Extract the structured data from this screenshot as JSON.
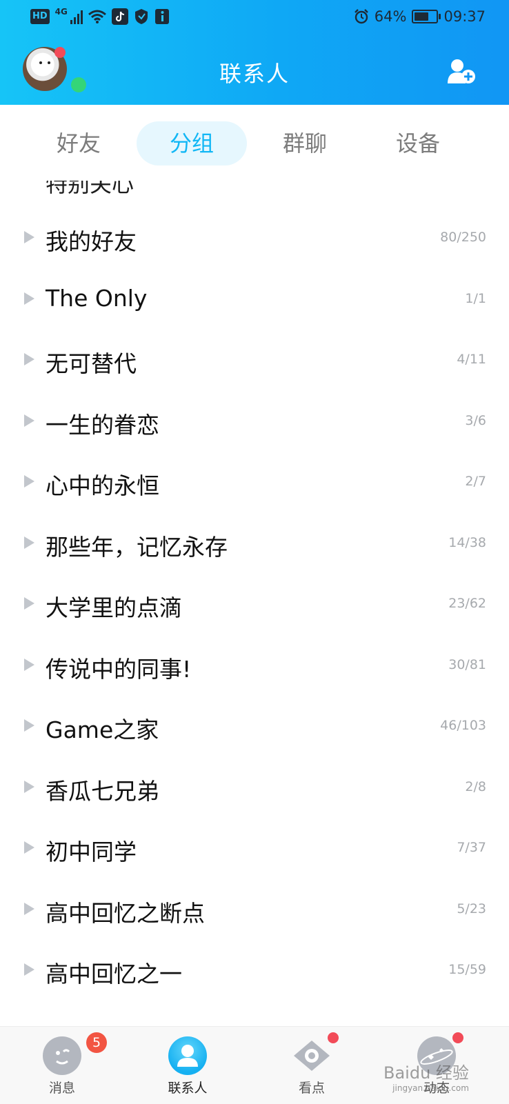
{
  "status_bar": {
    "hd": "HD",
    "network": "4G",
    "battery_percent": "64%",
    "battery_level": 0.64,
    "time": "09:37",
    "icons": [
      "signal-icon",
      "wifi-icon",
      "tiktok-icon",
      "shield-icon",
      "info-icon",
      "alarm-icon",
      "battery-icon"
    ]
  },
  "header": {
    "title": "联系人",
    "add_contact_icon": "add-contact-icon",
    "accent_color": "#12b7f5"
  },
  "tabs": [
    {
      "label": "好友"
    },
    {
      "label": "分组",
      "active": true
    },
    {
      "label": "群聊"
    },
    {
      "label": "设备"
    }
  ],
  "partial_row": "特别关心",
  "groups": [
    {
      "name": "我的好友",
      "count": "80/250"
    },
    {
      "name": "The Only",
      "count": "1/1"
    },
    {
      "name": "无可替代",
      "count": "4/11"
    },
    {
      "name": "一生的眷恋",
      "count": "3/6"
    },
    {
      "name": "心中的永恒",
      "count": "2/7"
    },
    {
      "name": "那些年，记忆永存",
      "count": "14/38"
    },
    {
      "name": "大学里的点滴",
      "count": "23/62"
    },
    {
      "name": "传说中的同事!",
      "count": "30/81"
    },
    {
      "name": "Game之家",
      "count": "46/103"
    },
    {
      "name": "香瓜七兄弟",
      "count": "2/8"
    },
    {
      "name": "初中同学",
      "count": "7/37"
    },
    {
      "name": "高中回忆之断点",
      "count": "5/23"
    },
    {
      "name": "高中回忆之一",
      "count": "15/59"
    }
  ],
  "bottom_nav": [
    {
      "label": "消息",
      "badge": "5",
      "icon": "message-icon"
    },
    {
      "label": "联系人",
      "active": true,
      "icon": "contacts-icon"
    },
    {
      "label": "看点",
      "icon": "eye-icon"
    },
    {
      "label": "动态",
      "icon": "planet-icon"
    }
  ],
  "watermark": {
    "text": "Baidu 经验",
    "sub": "jingyan.baidu.com"
  }
}
